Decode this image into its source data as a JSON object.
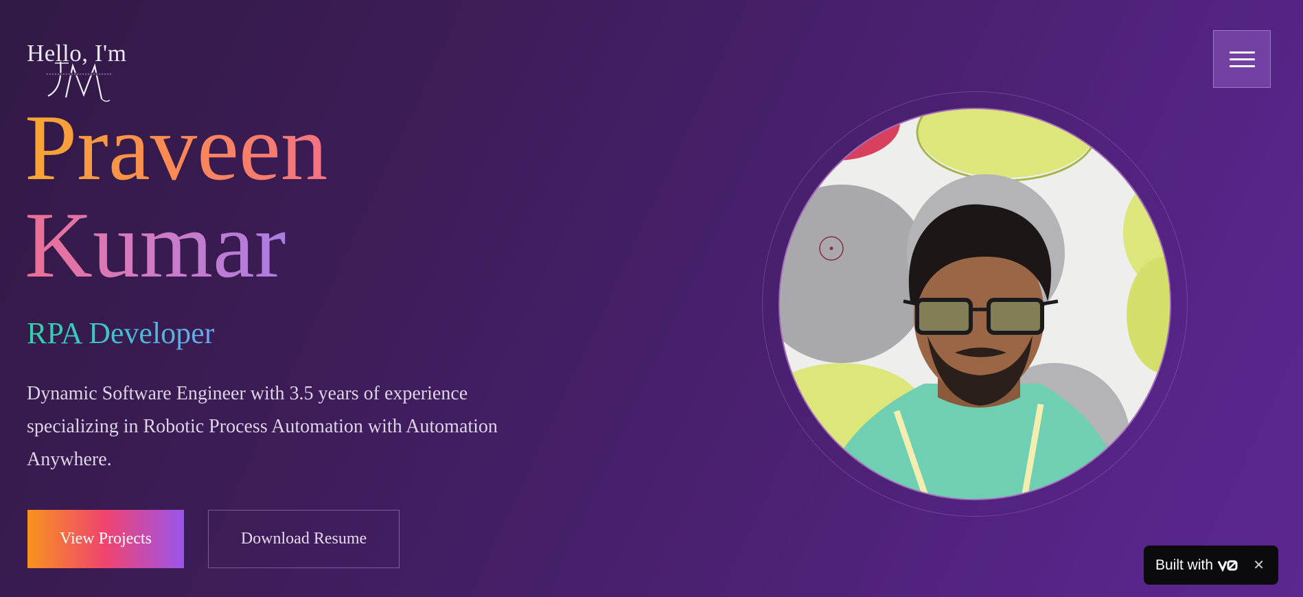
{
  "hero": {
    "greeting": "Hello, I'm",
    "first_name": "Praveen",
    "last_name": "Kumar",
    "role": "RPA Developer",
    "description": "Dynamic Software Engineer with 3.5 years of experience specializing in Robotic Process Automation with Automation Anywhere.",
    "primary_button": "View Projects",
    "secondary_button": "Download Resume"
  },
  "logo": {
    "monogram": "JM",
    "text": "JANDHIYA MANDEEP"
  },
  "menu": {
    "icon": "hamburger-menu-icon"
  },
  "badge": {
    "label": "Built with",
    "close_icon": "close-icon",
    "brand_icon": "v0-logo-icon"
  },
  "colors": {
    "background_start": "#311a45",
    "background_end": "#5b2790",
    "name_gradient_start": "#f7a731",
    "name_gradient_end": "#a57de6",
    "role_gradient_start": "#2fd3a5",
    "role_gradient_end": "#6aa7f0",
    "button_gradient_start": "#f7931e",
    "button_gradient_end": "#9a56ec"
  }
}
